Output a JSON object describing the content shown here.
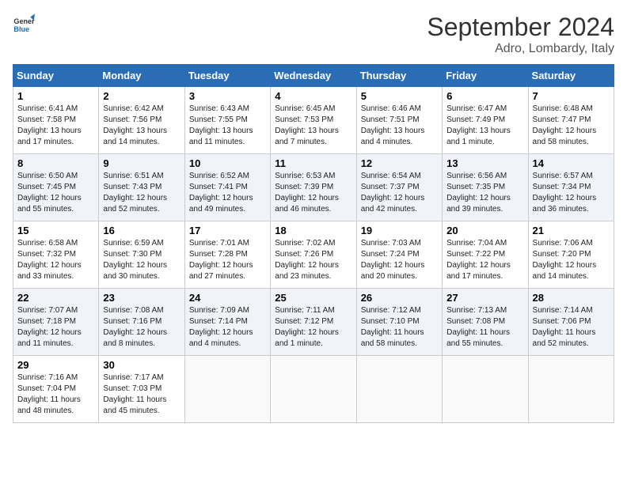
{
  "header": {
    "logo_line1": "General",
    "logo_line2": "Blue",
    "month_title": "September 2024",
    "location": "Adro, Lombardy, Italy"
  },
  "weekdays": [
    "Sunday",
    "Monday",
    "Tuesday",
    "Wednesday",
    "Thursday",
    "Friday",
    "Saturday"
  ],
  "weeks": [
    [
      {
        "day": "1",
        "sunrise": "6:41 AM",
        "sunset": "7:58 PM",
        "daylight": "13 hours and 17 minutes."
      },
      {
        "day": "2",
        "sunrise": "6:42 AM",
        "sunset": "7:56 PM",
        "daylight": "13 hours and 14 minutes."
      },
      {
        "day": "3",
        "sunrise": "6:43 AM",
        "sunset": "7:55 PM",
        "daylight": "13 hours and 11 minutes."
      },
      {
        "day": "4",
        "sunrise": "6:45 AM",
        "sunset": "7:53 PM",
        "daylight": "13 hours and 7 minutes."
      },
      {
        "day": "5",
        "sunrise": "6:46 AM",
        "sunset": "7:51 PM",
        "daylight": "13 hours and 4 minutes."
      },
      {
        "day": "6",
        "sunrise": "6:47 AM",
        "sunset": "7:49 PM",
        "daylight": "13 hours and 1 minute."
      },
      {
        "day": "7",
        "sunrise": "6:48 AM",
        "sunset": "7:47 PM",
        "daylight": "12 hours and 58 minutes."
      }
    ],
    [
      {
        "day": "8",
        "sunrise": "6:50 AM",
        "sunset": "7:45 PM",
        "daylight": "12 hours and 55 minutes."
      },
      {
        "day": "9",
        "sunrise": "6:51 AM",
        "sunset": "7:43 PM",
        "daylight": "12 hours and 52 minutes."
      },
      {
        "day": "10",
        "sunrise": "6:52 AM",
        "sunset": "7:41 PM",
        "daylight": "12 hours and 49 minutes."
      },
      {
        "day": "11",
        "sunrise": "6:53 AM",
        "sunset": "7:39 PM",
        "daylight": "12 hours and 46 minutes."
      },
      {
        "day": "12",
        "sunrise": "6:54 AM",
        "sunset": "7:37 PM",
        "daylight": "12 hours and 42 minutes."
      },
      {
        "day": "13",
        "sunrise": "6:56 AM",
        "sunset": "7:35 PM",
        "daylight": "12 hours and 39 minutes."
      },
      {
        "day": "14",
        "sunrise": "6:57 AM",
        "sunset": "7:34 PM",
        "daylight": "12 hours and 36 minutes."
      }
    ],
    [
      {
        "day": "15",
        "sunrise": "6:58 AM",
        "sunset": "7:32 PM",
        "daylight": "12 hours and 33 minutes."
      },
      {
        "day": "16",
        "sunrise": "6:59 AM",
        "sunset": "7:30 PM",
        "daylight": "12 hours and 30 minutes."
      },
      {
        "day": "17",
        "sunrise": "7:01 AM",
        "sunset": "7:28 PM",
        "daylight": "12 hours and 27 minutes."
      },
      {
        "day": "18",
        "sunrise": "7:02 AM",
        "sunset": "7:26 PM",
        "daylight": "12 hours and 23 minutes."
      },
      {
        "day": "19",
        "sunrise": "7:03 AM",
        "sunset": "7:24 PM",
        "daylight": "12 hours and 20 minutes."
      },
      {
        "day": "20",
        "sunrise": "7:04 AM",
        "sunset": "7:22 PM",
        "daylight": "12 hours and 17 minutes."
      },
      {
        "day": "21",
        "sunrise": "7:06 AM",
        "sunset": "7:20 PM",
        "daylight": "12 hours and 14 minutes."
      }
    ],
    [
      {
        "day": "22",
        "sunrise": "7:07 AM",
        "sunset": "7:18 PM",
        "daylight": "12 hours and 11 minutes."
      },
      {
        "day": "23",
        "sunrise": "7:08 AM",
        "sunset": "7:16 PM",
        "daylight": "12 hours and 8 minutes."
      },
      {
        "day": "24",
        "sunrise": "7:09 AM",
        "sunset": "7:14 PM",
        "daylight": "12 hours and 4 minutes."
      },
      {
        "day": "25",
        "sunrise": "7:11 AM",
        "sunset": "7:12 PM",
        "daylight": "12 hours and 1 minute."
      },
      {
        "day": "26",
        "sunrise": "7:12 AM",
        "sunset": "7:10 PM",
        "daylight": "11 hours and 58 minutes."
      },
      {
        "day": "27",
        "sunrise": "7:13 AM",
        "sunset": "7:08 PM",
        "daylight": "11 hours and 55 minutes."
      },
      {
        "day": "28",
        "sunrise": "7:14 AM",
        "sunset": "7:06 PM",
        "daylight": "11 hours and 52 minutes."
      }
    ],
    [
      {
        "day": "29",
        "sunrise": "7:16 AM",
        "sunset": "7:04 PM",
        "daylight": "11 hours and 48 minutes."
      },
      {
        "day": "30",
        "sunrise": "7:17 AM",
        "sunset": "7:03 PM",
        "daylight": "11 hours and 45 minutes."
      },
      null,
      null,
      null,
      null,
      null
    ]
  ]
}
